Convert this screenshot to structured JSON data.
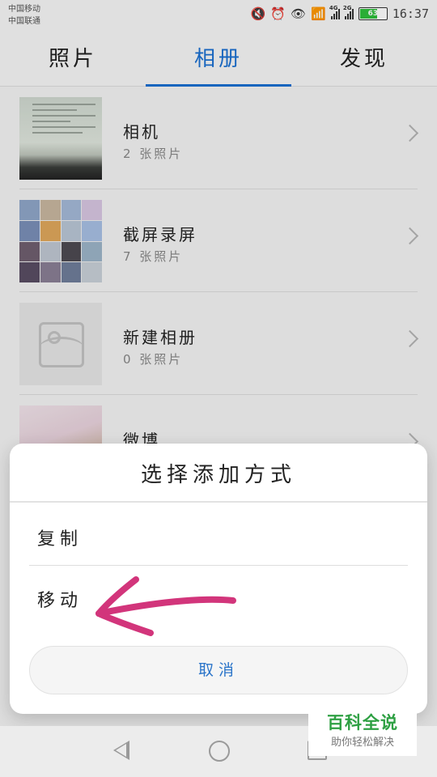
{
  "status_bar": {
    "carrier_1": "中国移动",
    "carrier_2": "中国联通",
    "net_1": "4G",
    "net_2": "2G",
    "battery": "63",
    "time": "16:37",
    "icons": [
      "mute-icon",
      "alarm-icon",
      "eye-icon",
      "wifi-icon",
      "signal-icon",
      "signal-icon",
      "battery-icon"
    ]
  },
  "tabs": [
    {
      "label": "照片",
      "active": false
    },
    {
      "label": "相册",
      "active": true
    },
    {
      "label": "发现",
      "active": false
    }
  ],
  "accent_color": "#1a6fd1",
  "albums": [
    {
      "name": "相机",
      "count": "2 张照片"
    },
    {
      "name": "截屏录屏",
      "count": "7 张照片"
    },
    {
      "name": "新建相册",
      "count": "0 张照片"
    },
    {
      "name": "微博",
      "count": ""
    }
  ],
  "dialog": {
    "title": "选择添加方式",
    "options": [
      "复制",
      "移动"
    ],
    "cancel": "取消",
    "annotation": "pink-arrow pointing at 移动"
  },
  "nav": {
    "icons": [
      "back-icon",
      "home-icon",
      "recent-apps-icon"
    ]
  },
  "watermark": {
    "brand": "百科全说",
    "slogan": "助你轻松解决"
  }
}
